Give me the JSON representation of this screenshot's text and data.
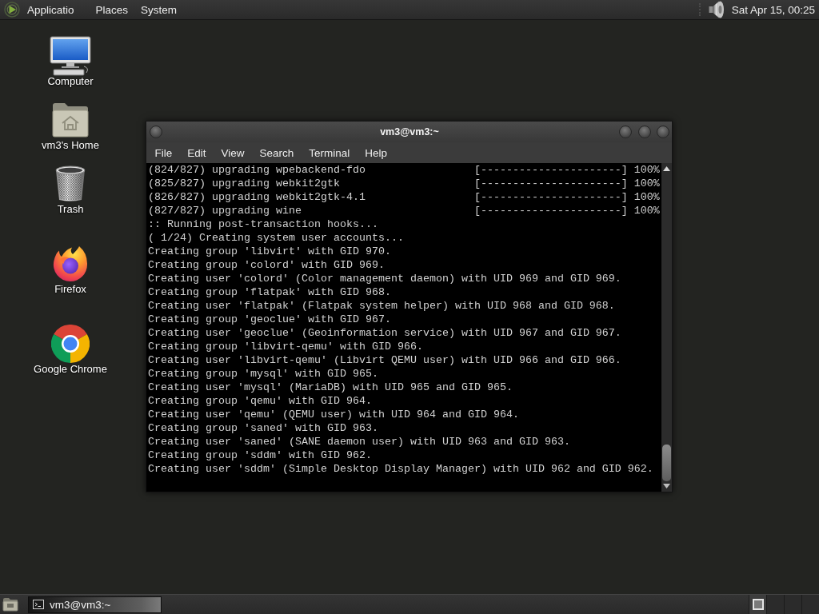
{
  "top_panel": {
    "menus": [
      "Applicatio",
      "Places",
      "System"
    ],
    "clock": "Sat Apr 15, 00:25"
  },
  "desktop_icons": [
    {
      "kind": "computer",
      "label": "Computer"
    },
    {
      "kind": "home",
      "label": "vm3's Home"
    },
    {
      "kind": "trash",
      "label": "Trash"
    },
    {
      "kind": "firefox",
      "label": "Firefox"
    },
    {
      "kind": "chrome",
      "label": "Google Chrome"
    }
  ],
  "terminal": {
    "title": "vm3@vm3:~",
    "menu": [
      "File",
      "Edit",
      "View",
      "Search",
      "Terminal",
      "Help"
    ],
    "lines": [
      {
        "kind": "progress",
        "text": "(824/827) upgrading wpebackend-fdo",
        "bar": "[----------------------]",
        "percent": "100%"
      },
      {
        "kind": "progress",
        "text": "(825/827) upgrading webkit2gtk",
        "bar": "[----------------------]",
        "percent": "100%"
      },
      {
        "kind": "progress",
        "text": "(826/827) upgrading webkit2gtk-4.1",
        "bar": "[----------------------]",
        "percent": "100%"
      },
      {
        "kind": "progress",
        "text": "(827/827) upgrading wine",
        "bar": "[----------------------]",
        "percent": "100%"
      },
      {
        "kind": "text",
        "text": ":: Running post-transaction hooks..."
      },
      {
        "kind": "text",
        "text": "( 1/24) Creating system user accounts..."
      },
      {
        "kind": "text",
        "text": "Creating group 'libvirt' with GID 970."
      },
      {
        "kind": "text",
        "text": "Creating group 'colord' with GID 969."
      },
      {
        "kind": "text",
        "text": "Creating user 'colord' (Color management daemon) with UID 969 and GID 969."
      },
      {
        "kind": "text",
        "text": "Creating group 'flatpak' with GID 968."
      },
      {
        "kind": "text",
        "text": "Creating user 'flatpak' (Flatpak system helper) with UID 968 and GID 968."
      },
      {
        "kind": "text",
        "text": "Creating group 'geoclue' with GID 967."
      },
      {
        "kind": "text",
        "text": "Creating user 'geoclue' (Geoinformation service) with UID 967 and GID 967."
      },
      {
        "kind": "text",
        "text": "Creating group 'libvirt-qemu' with GID 966."
      },
      {
        "kind": "text",
        "text": "Creating user 'libvirt-qemu' (Libvirt QEMU user) with UID 966 and GID 966."
      },
      {
        "kind": "text",
        "text": "Creating group 'mysql' with GID 965."
      },
      {
        "kind": "text",
        "text": "Creating user 'mysql' (MariaDB) with UID 965 and GID 965."
      },
      {
        "kind": "text",
        "text": "Creating group 'qemu' with GID 964."
      },
      {
        "kind": "text",
        "text": "Creating user 'qemu' (QEMU user) with UID 964 and GID 964."
      },
      {
        "kind": "text",
        "text": "Creating group 'saned' with GID 963."
      },
      {
        "kind": "text",
        "text": "Creating user 'saned' (SANE daemon user) with UID 963 and GID 963."
      },
      {
        "kind": "text",
        "text": "Creating group 'sddm' with GID 962."
      },
      {
        "kind": "text",
        "text": "Creating user 'sddm' (Simple Desktop Display Manager) with UID 962 and GID 962."
      }
    ]
  },
  "taskbar": {
    "windows": [
      {
        "label": "vm3@vm3:~",
        "selected": true
      }
    ],
    "workspaces": [
      {
        "selected": true
      },
      {
        "selected": false
      },
      {
        "selected": false
      },
      {
        "selected": false
      }
    ]
  }
}
